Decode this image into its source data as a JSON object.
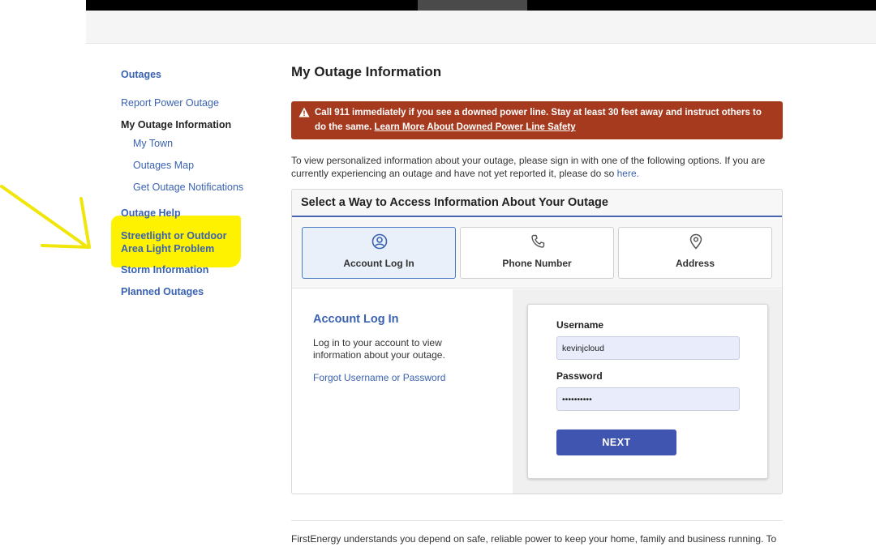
{
  "sidebar": {
    "items": [
      {
        "label": "Outages"
      },
      {
        "label": "Report Power Outage"
      },
      {
        "label": "My Outage Information"
      },
      {
        "label": "My Town"
      },
      {
        "label": "Outages Map"
      },
      {
        "label": "Get Outage Notifications"
      },
      {
        "label": "Outage Help"
      },
      {
        "label": "Streetlight or Outdoor Area Light Problem"
      },
      {
        "label": "Storm Information"
      },
      {
        "label": "Planned Outages"
      }
    ],
    "highlight_color": "#fff200"
  },
  "main": {
    "title": "My Outage Information",
    "alert": {
      "text": "Call 911 immediately if you see a downed power line. Stay at least 30 feet away and instruct others to do the same.",
      "link": "Learn More About Downed Power Line Safety",
      "color": "#a53a1e"
    },
    "intro": {
      "text": "To view personalized information about your outage, please sign in with one of the following options. If you are currently experiencing an outage and have not yet reported it, please do so",
      "link": "here."
    },
    "access_panel": {
      "heading": "Select a Way to Access Information About Your Outage",
      "options": [
        {
          "label": "Account Log In",
          "icon": "user-circle-icon",
          "selected": true
        },
        {
          "label": "Phone Number",
          "icon": "phone-icon",
          "selected": false
        },
        {
          "label": "Address",
          "icon": "map-pin-icon",
          "selected": false
        }
      ],
      "account_login": {
        "title": "Account Log In",
        "description": "Log in to your account to view information about your outage.",
        "forgot_link": "Forgot Username or Password"
      },
      "form": {
        "username_label": "Username",
        "username_value": "kevinjcloud",
        "password_label": "Password",
        "password_value": "••••••••••",
        "next_label": "NEXT"
      }
    },
    "footer_text": "FirstEnergy understands you depend on safe, reliable power to keep your home, family and business running. To"
  },
  "colors": {
    "link": "#3a62b0",
    "button": "#3f55b0",
    "annotation_arrow": "#f0e60a"
  }
}
